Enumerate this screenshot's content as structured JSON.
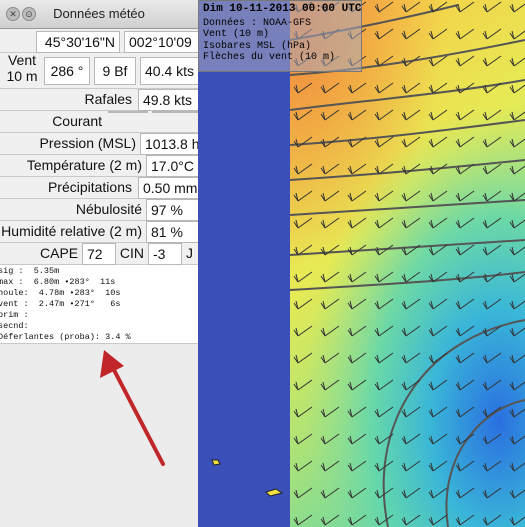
{
  "window": {
    "title": "Données météo"
  },
  "position": {
    "lat": "45°30'16\"N",
    "lon": "002°10'09"
  },
  "wind": {
    "label_top": "Vent",
    "label_bottom": "10 m",
    "direction": "286 °",
    "beaufort": "9 Bf",
    "speed": "40.4 kts"
  },
  "gusts": {
    "label": "Rafales",
    "value": "49.8 kts"
  },
  "current": {
    "label": "Courant",
    "value": ""
  },
  "pressure": {
    "label": "Pression (MSL)",
    "value": "1013.8 h"
  },
  "temperature": {
    "label": "Température (2 m)",
    "value": "17.0°C"
  },
  "precip": {
    "label": "Précipitations",
    "value": "0.50 mm"
  },
  "cloud": {
    "label": "Nébulosité",
    "value": "97 %"
  },
  "humidity": {
    "label": "Humidité relative (2 m)",
    "value": "81 %"
  },
  "cape": {
    "label": "CAPE",
    "value": "72",
    "cin_label": "CIN",
    "cin_value": "-3",
    "unit": "J"
  },
  "waves": [
    "sig :  5.35m",
    "max :  6.80m •283°  11s",
    "houle:  4.78m •283°  10s",
    "vent :  2.47m •271°   6s",
    "prim :",
    "secnd:",
    "Déferlantes (proba): 3.4 %"
  ],
  "map_info": {
    "date": "Dim 10-11-2013 00:00 UTC",
    "source": "Données : NOAA-GFS",
    "layer1": "Vent (10 m)",
    "layer2": "Isobares MSL (hPa)",
    "layer3": "Flèches du vent (10 m)"
  },
  "colors": {
    "arrow": "#c0262a",
    "sea_blue": "#3b4fb8",
    "land_border": "#222222"
  }
}
